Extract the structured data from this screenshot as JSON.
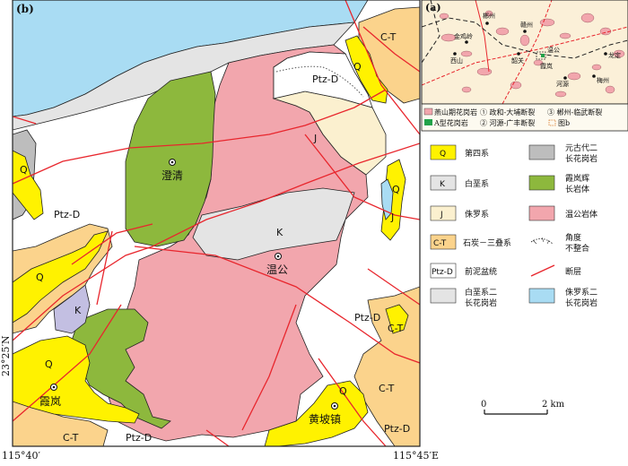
{
  "panel_b_label": "(b)",
  "panel_a_label": "(a)",
  "map_labels": {
    "q": "Q",
    "ct": "C-T",
    "ptzd": "Ptz-D",
    "j": "J",
    "k": "K"
  },
  "places": {
    "chengqing": "澄清",
    "wengong": "温公",
    "xialan": "霞岚",
    "huangpozhen": "黄坡镇"
  },
  "coords": {
    "lon_left": "115°40′",
    "lon_right": "115°45′E",
    "lat": "23°25′N"
  },
  "scale": {
    "zero": "0",
    "two": "2 km"
  },
  "inset_places": [
    "金鸡岭",
    "郴州",
    "赣州",
    "西山",
    "韶关",
    "河源",
    "梅州",
    "龙定",
    "温公",
    "霞岚"
  ],
  "inset_legend": {
    "yanshan": "燕山期花岗岩",
    "fault1": "① 政和-大埔断裂",
    "fault3": "③ 郴州-临武断裂",
    "atype": "A型花岗岩",
    "fault2": "② 河源-广丰断裂",
    "figb": "图b"
  },
  "legend": {
    "q": "第四系",
    "k": "白垩系",
    "j": "侏罗系",
    "ct": "石炭－三叠系",
    "ptzd": "前泥盆统",
    "cret_granite": [
      "白垩系二",
      "长花岗岩"
    ],
    "proto_granite": [
      "元古代二",
      "长花岗岩"
    ],
    "xialan_gabbro": [
      "霞岚辉",
      "长岩体"
    ],
    "wengong_body": "温公岩体",
    "unconformity": [
      "角度",
      "不整合"
    ],
    "fault": "断层",
    "jur_granite": [
      "侏罗系二",
      "长花岗岩"
    ]
  },
  "colors": {
    "quaternary": "#fff200",
    "c_t": "#fbd38c",
    "cretaceous": "#e4e4e4",
    "jurassic": "#fbf0cf",
    "wengong_granite": "#f2a6ad",
    "xialan_gabbro": "#8db83d",
    "jur_granite": "#a9dcf3",
    "proto_granite": "#bdbdbd",
    "k_purple": "#c3bfe2",
    "fault": "#e8262d",
    "atype": "#21a24a"
  }
}
